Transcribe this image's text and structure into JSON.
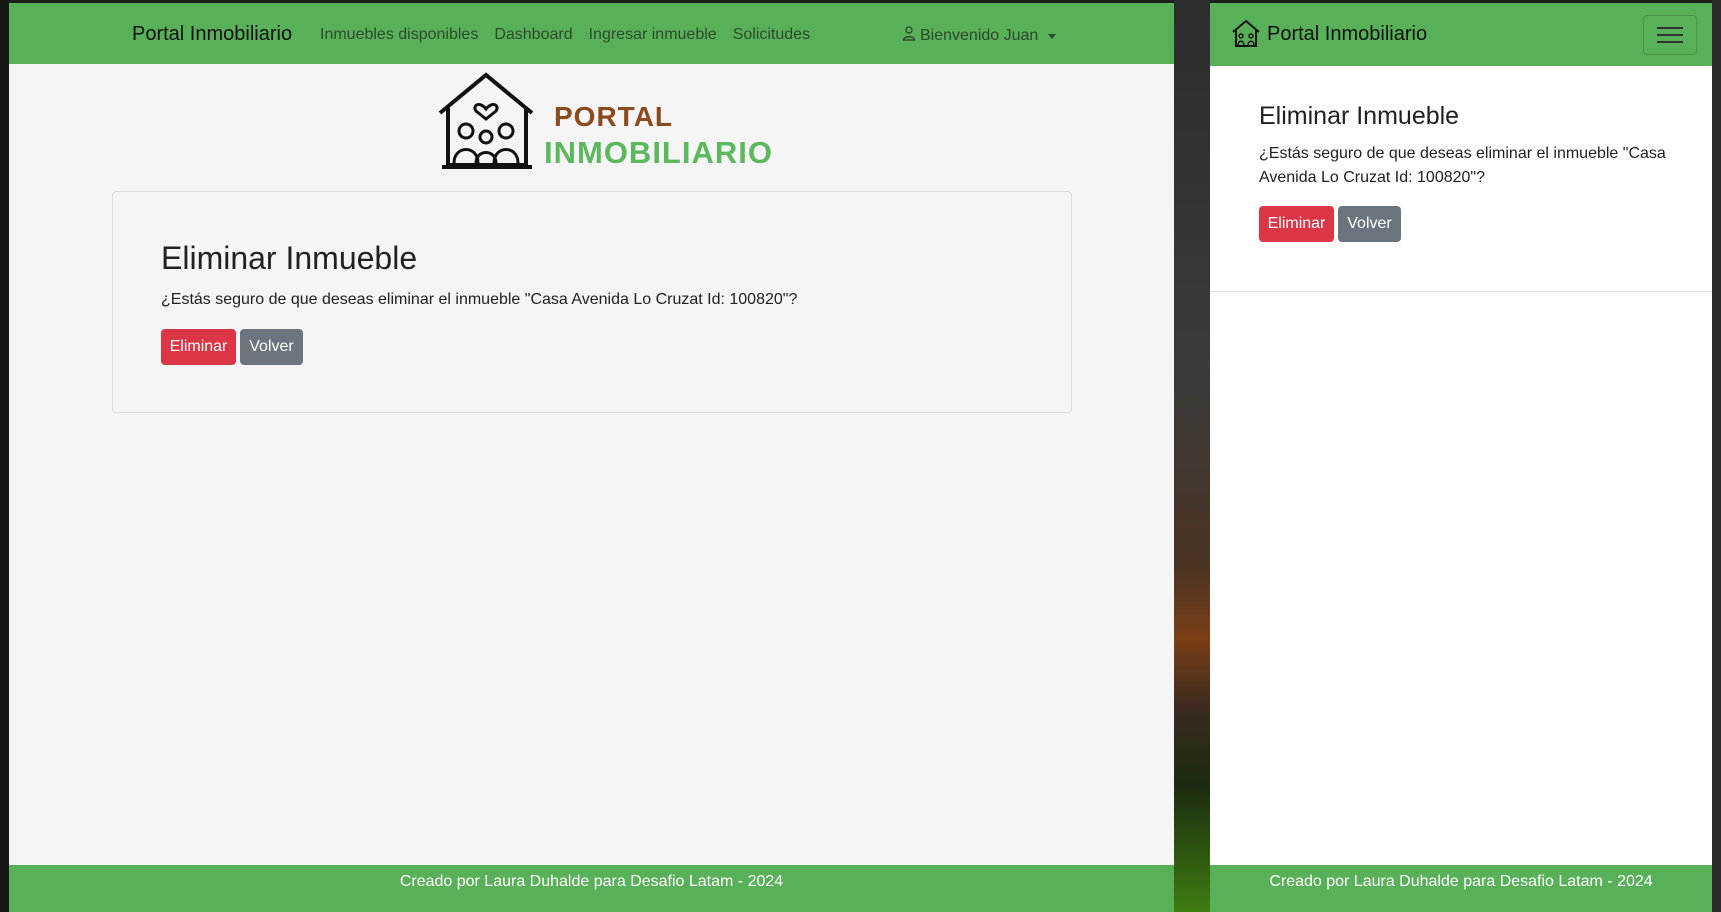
{
  "desktop": {
    "left_window": {
      "navbar": {
        "brand": "Portal Inmobiliario",
        "links": [
          "Inmuebles disponibles",
          "Dashboard",
          "Ingresar inmueble",
          "Solicitudes"
        ],
        "user_menu": "Bienvenido Juan",
        "user_icon": "person-icon"
      },
      "logo": {
        "line1": "PORTAL",
        "line2": "INMOBILIARIO",
        "icon": "house-family-icon"
      },
      "card": {
        "title": "Eliminar Inmueble",
        "message": "¿Estás seguro de que deseas eliminar el inmueble \"Casa Avenida Lo Cruzat Id: 100820\"?",
        "delete_label": "Eliminar",
        "back_label": "Volver"
      },
      "footer": "Creado por Laura Duhalde para Desafio Latam - 2024"
    },
    "right_window": {
      "navbar": {
        "brand": "Portal Inmobiliario",
        "toggler_icon": "hamburger-menu-icon"
      },
      "card": {
        "title": "Eliminar Inmueble",
        "message": "¿Estás seguro de que deseas eliminar el inmueble \"Casa Avenida Lo Cruzat Id: 100820\"?",
        "delete_label": "Eliminar",
        "back_label": "Volver"
      },
      "footer": "Creado por Laura Duhalde para Desafio Latam - 2024"
    }
  },
  "colors": {
    "navbar": "#58b058",
    "danger": "#dc3545",
    "secondary": "#6c757d",
    "logo_brown": "#8a4b1f",
    "logo_green": "#5cb85c"
  }
}
